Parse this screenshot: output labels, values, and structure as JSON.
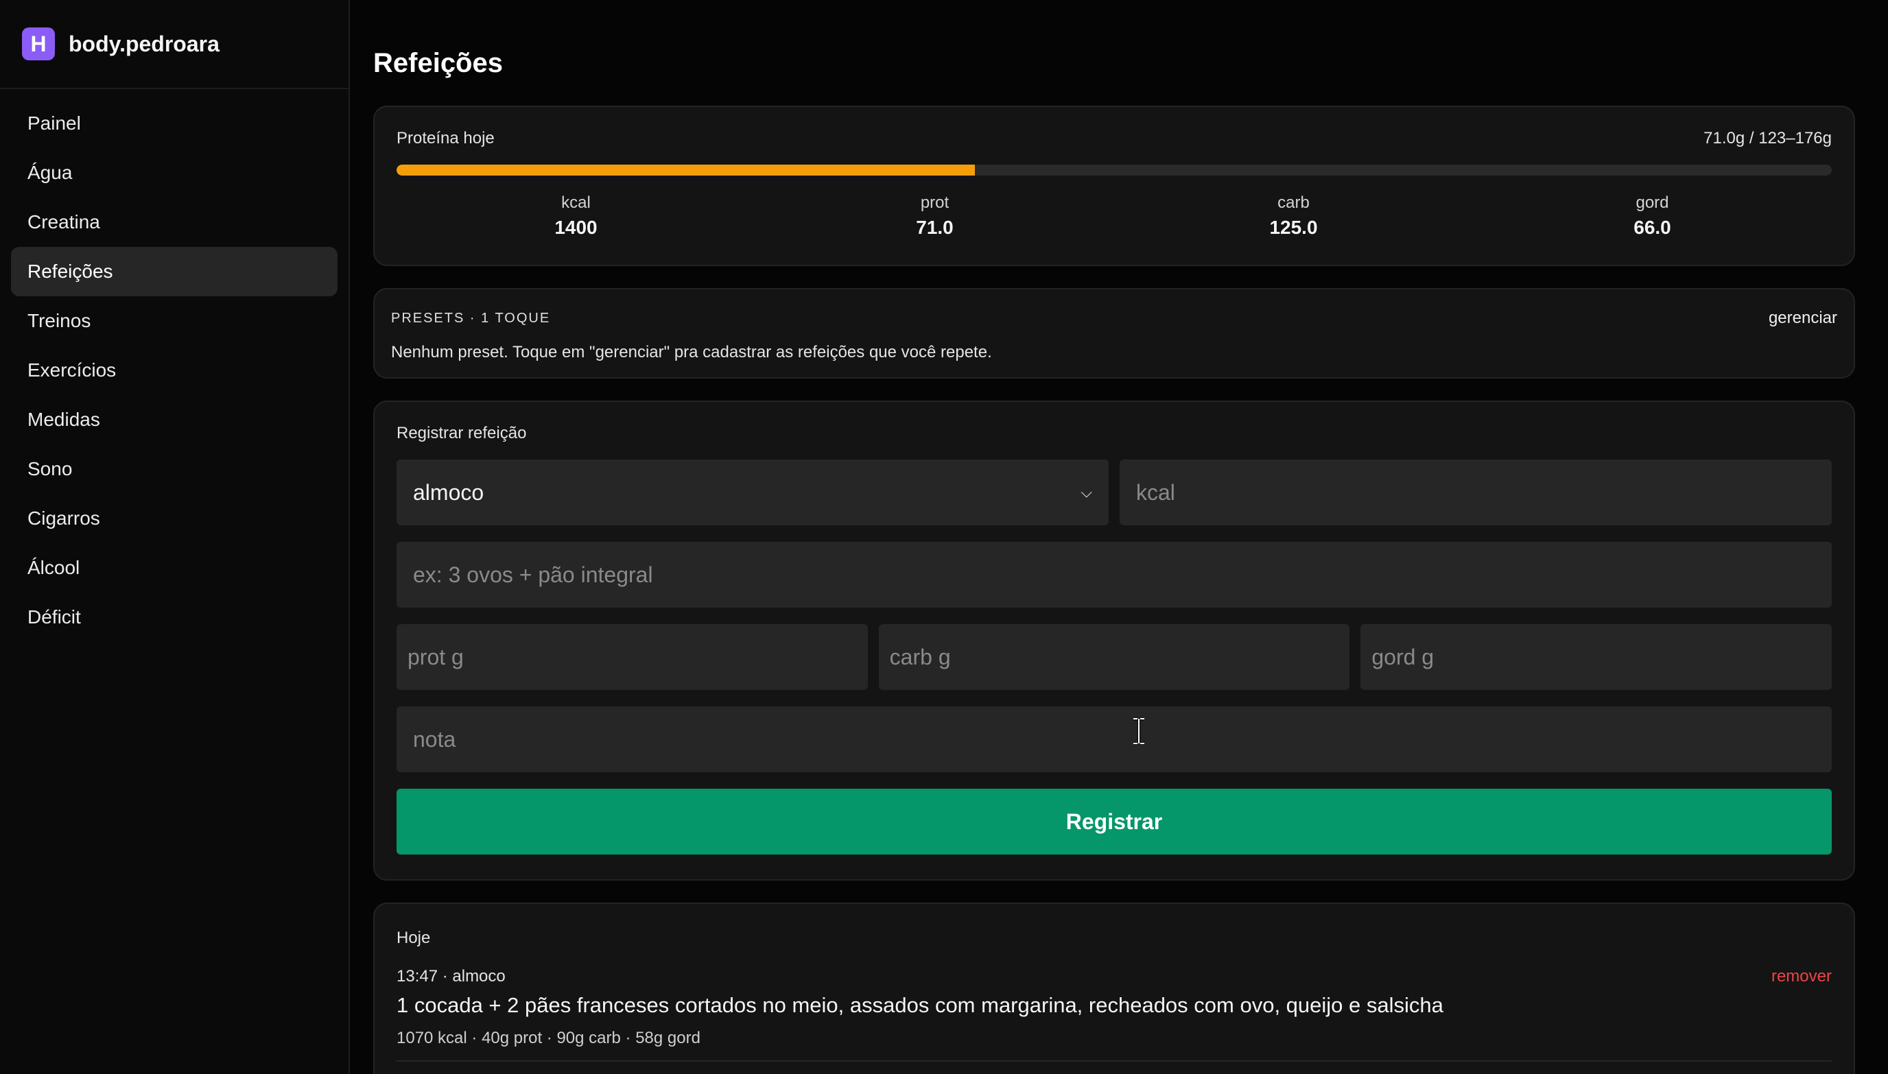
{
  "brand": {
    "logo_letter": "H",
    "name": "body.pedroara",
    "accent": "#8b5cf6"
  },
  "sidebar": {
    "items": [
      {
        "label": "Painel",
        "active": false
      },
      {
        "label": "Água",
        "active": false
      },
      {
        "label": "Creatina",
        "active": false
      },
      {
        "label": "Refeições",
        "active": true
      },
      {
        "label": "Treinos",
        "active": false
      },
      {
        "label": "Exercícios",
        "active": false
      },
      {
        "label": "Medidas",
        "active": false
      },
      {
        "label": "Sono",
        "active": false
      },
      {
        "label": "Cigarros",
        "active": false
      },
      {
        "label": "Álcool",
        "active": false
      },
      {
        "label": "Déficit",
        "active": false
      }
    ]
  },
  "page": {
    "title": "Refeições"
  },
  "protein": {
    "label": "Proteína hoje",
    "summary": "71.0g / 123–176g",
    "progress_fraction": 0.403,
    "bar_color": "#f59e0b",
    "macros": [
      {
        "label": "kcal",
        "value": "1400"
      },
      {
        "label": "prot",
        "value": "71.0"
      },
      {
        "label": "carb",
        "value": "125.0"
      },
      {
        "label": "gord",
        "value": "66.0"
      }
    ]
  },
  "presets": {
    "title": "PRESETS · 1 TOQUE",
    "manage_label": "gerenciar",
    "empty_text": "Nenhum preset. Toque em \"gerenciar\" pra cadastrar as refeições que você repete."
  },
  "form": {
    "title": "Registrar refeição",
    "meal_type_value": "almoco",
    "kcal_placeholder": "kcal",
    "description_placeholder": "ex: 3 ovos + pão integral",
    "prot_placeholder": "prot g",
    "carb_placeholder": "carb g",
    "gord_placeholder": "gord g",
    "note_placeholder": "nota",
    "submit_label": "Registrar",
    "submit_color": "#059669"
  },
  "today": {
    "title": "Hoje",
    "entries": [
      {
        "meta": "13:47 · almoco",
        "remove_label": "remover",
        "description": "1 cocada + 2 pães franceses cortados no meio, assados com margarina, recheados com ovo, queijo e salsicha",
        "macros": "1070 kcal · 40g prot · 90g carb · 58g gord"
      }
    ]
  }
}
